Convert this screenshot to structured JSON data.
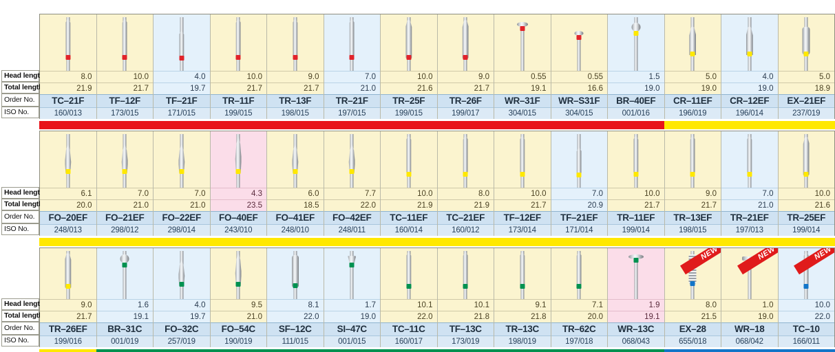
{
  "row_labels": [
    "Head length",
    "Total length",
    "Order No.",
    "ISO No."
  ],
  "palette": {
    "cream": "#fbf4cf",
    "blue": "#e4f1fb",
    "pink": "#fbdde9",
    "order_bg": "#cfe2f2",
    "iso_bg": "#dceaf6",
    "red": "#e8131a",
    "yellow": "#ffe800",
    "green": "#009150",
    "blue_bar": "#1275c8",
    "new_badge": "#e01b1b"
  },
  "new_badge_label": "NEW",
  "bands": [
    {
      "name": "band-1",
      "bottom_bar": [
        {
          "color": "#e8131a",
          "span": 11
        },
        {
          "color": "#ffe800",
          "span": 3
        }
      ],
      "columns": [
        {
          "bg": "cream",
          "head_length": "8.0",
          "total_length": "21.9",
          "order_no": "TC–21F",
          "iso_no": "160/013",
          "shape": "needle",
          "ring": "#e1232a",
          "new": false
        },
        {
          "bg": "cream",
          "head_length": "10.0",
          "total_length": "21.7",
          "order_no": "TF–12F",
          "iso_no": "173/015",
          "shape": "needle",
          "ring": "#e1232a",
          "new": false
        },
        {
          "bg": "blue",
          "head_length": "4.0",
          "total_length": "19.7",
          "order_no": "TF–21F",
          "iso_no": "171/015",
          "shape": "needle-short",
          "ring": "#e1232a",
          "new": false
        },
        {
          "bg": "cream",
          "head_length": "10.0",
          "total_length": "21.7",
          "order_no": "TR–11F",
          "iso_no": "199/015",
          "shape": "taper",
          "ring": "#e1232a",
          "new": false
        },
        {
          "bg": "cream",
          "head_length": "9.0",
          "total_length": "21.7",
          "order_no": "TR–13F",
          "iso_no": "198/015",
          "shape": "taper",
          "ring": "#e1232a",
          "new": false
        },
        {
          "bg": "blue",
          "head_length": "7.0",
          "total_length": "21.0",
          "order_no": "TR–21F",
          "iso_no": "197/015",
          "shape": "taper",
          "ring": "#e1232a",
          "new": false
        },
        {
          "bg": "cream",
          "head_length": "10.0",
          "total_length": "21.6",
          "order_no": "TR–25F",
          "iso_no": "199/015",
          "shape": "round-end",
          "ring": "#e1232a",
          "new": false
        },
        {
          "bg": "cream",
          "head_length": "9.0",
          "total_length": "21.7",
          "order_no": "TR–26F",
          "iso_no": "199/017",
          "shape": "round-end",
          "ring": "#e1232a",
          "new": false
        },
        {
          "bg": "cream",
          "head_length": "0.55",
          "total_length": "19.1",
          "order_no": "WR–31F",
          "iso_no": "304/015",
          "shape": "wheel",
          "ring": "#e1232a",
          "new": false
        },
        {
          "bg": "cream",
          "head_length": "0.55",
          "total_length": "16.6",
          "order_no": "WR–S31F",
          "iso_no": "304/015",
          "shape": "wheel-small",
          "ring": "#e1232a",
          "new": false
        },
        {
          "bg": "blue",
          "head_length": "1.5",
          "total_length": "19.0",
          "order_no": "BR–40EF",
          "iso_no": "001/016",
          "shape": "ball",
          "ring": "#ffe800",
          "new": false
        },
        {
          "bg": "cream",
          "head_length": "5.0",
          "total_length": "19.0",
          "order_no": "CR–11EF",
          "iso_no": "196/019",
          "shape": "cone-round",
          "ring": "#ffe800",
          "new": false
        },
        {
          "bg": "blue",
          "head_length": "4.0",
          "total_length": "19.0",
          "order_no": "CR–12EF",
          "iso_no": "196/014",
          "shape": "cone-round",
          "ring": "#ffe800",
          "new": false
        },
        {
          "bg": "cream",
          "head_length": "5.0",
          "total_length": "18.9",
          "order_no": "EX–21EF",
          "iso_no": "237/019",
          "shape": "barrel",
          "ring": "#ffe800",
          "new": false
        }
      ]
    },
    {
      "name": "band-2",
      "bottom_bar": [
        {
          "color": "#ffe800",
          "span": 14
        }
      ],
      "columns": [
        {
          "bg": "cream",
          "head_length": "6.1",
          "total_length": "20.0",
          "order_no": "FO–20EF",
          "iso_no": "248/013",
          "shape": "flame",
          "ring": "#ffe800",
          "new": false
        },
        {
          "bg": "cream",
          "head_length": "7.0",
          "total_length": "21.0",
          "order_no": "FO–21EF",
          "iso_no": "298/012",
          "shape": "flame",
          "ring": "#ffe800",
          "new": false
        },
        {
          "bg": "cream",
          "head_length": "7.0",
          "total_length": "21.0",
          "order_no": "FO–22EF",
          "iso_no": "298/014",
          "shape": "flame",
          "ring": "#ffe800",
          "new": false
        },
        {
          "bg": "pink",
          "head_length": "4.3",
          "total_length": "23.5",
          "order_no": "FO–40EF",
          "iso_no": "243/010",
          "shape": "flame-long",
          "ring": "#ffe800",
          "new": false
        },
        {
          "bg": "cream",
          "head_length": "6.0",
          "total_length": "18.5",
          "order_no": "FO–41EF",
          "iso_no": "248/010",
          "shape": "flame",
          "ring": "#ffe800",
          "new": false
        },
        {
          "bg": "cream",
          "head_length": "7.7",
          "total_length": "22.0",
          "order_no": "FO–42EF",
          "iso_no": "248/011",
          "shape": "flame",
          "ring": "#ffe800",
          "new": false
        },
        {
          "bg": "cream",
          "head_length": "10.0",
          "total_length": "21.9",
          "order_no": "TC–11EF",
          "iso_no": "160/014",
          "shape": "needle",
          "ring": "#ffe800",
          "new": false
        },
        {
          "bg": "cream",
          "head_length": "8.0",
          "total_length": "21.9",
          "order_no": "TC–21EF",
          "iso_no": "160/012",
          "shape": "needle",
          "ring": "#ffe800",
          "new": false
        },
        {
          "bg": "cream",
          "head_length": "10.0",
          "total_length": "21.7",
          "order_no": "TF–12EF",
          "iso_no": "173/014",
          "shape": "needle",
          "ring": "#ffe800",
          "new": false
        },
        {
          "bg": "blue",
          "head_length": "7.0",
          "total_length": "20.9",
          "order_no": "TF–21EF",
          "iso_no": "171/014",
          "shape": "needle-short",
          "ring": "#ffe800",
          "new": false
        },
        {
          "bg": "cream",
          "head_length": "10.0",
          "total_length": "21.7",
          "order_no": "TR–11EF",
          "iso_no": "199/014",
          "shape": "taper",
          "ring": "#ffe800",
          "new": false
        },
        {
          "bg": "cream",
          "head_length": "9.0",
          "total_length": "21.7",
          "order_no": "TR–13EF",
          "iso_no": "198/015",
          "shape": "taper",
          "ring": "#ffe800",
          "new": false
        },
        {
          "bg": "blue",
          "head_length": "7.0",
          "total_length": "21.0",
          "order_no": "TR–21EF",
          "iso_no": "197/013",
          "shape": "taper",
          "ring": "#ffe800",
          "new": false
        },
        {
          "bg": "cream",
          "head_length": "10.0",
          "total_length": "21.6",
          "order_no": "TR–25EF",
          "iso_no": "199/014",
          "shape": "round-end",
          "ring": "#ffe800",
          "new": false
        }
      ]
    },
    {
      "name": "band-3",
      "bottom_bar": [
        {
          "color": "#ffe800",
          "span": 1
        },
        {
          "color": "#009150",
          "span": 10
        },
        {
          "color": "#1275c8",
          "span": 3
        }
      ],
      "columns": [
        {
          "bg": "cream",
          "head_length": "9.0",
          "total_length": "21.7",
          "order_no": "TR–26EF",
          "iso_no": "199/016",
          "shape": "round-end",
          "ring": "#ffe800",
          "new": false
        },
        {
          "bg": "blue",
          "head_length": "1.6",
          "total_length": "19.1",
          "order_no": "BR–31C",
          "iso_no": "001/019",
          "shape": "ball",
          "ring": "#009150",
          "new": false
        },
        {
          "bg": "blue",
          "head_length": "4.0",
          "total_length": "19.7",
          "order_no": "FO–32C",
          "iso_no": "257/019",
          "shape": "flame",
          "ring": "#009150",
          "new": false
        },
        {
          "bg": "cream",
          "head_length": "9.5",
          "total_length": "21.0",
          "order_no": "FO–54C",
          "iso_no": "190/019",
          "shape": "flame-long",
          "ring": "#009150",
          "new": false
        },
        {
          "bg": "blue",
          "head_length": "8.1",
          "total_length": "22.0",
          "order_no": "SF–12C",
          "iso_no": "111/015",
          "shape": "cylinder",
          "ring": "#009150",
          "new": false
        },
        {
          "bg": "blue",
          "head_length": "1.7",
          "total_length": "19.0",
          "order_no": "SI–47C",
          "iso_no": "001/015",
          "shape": "inverted",
          "ring": "#009150",
          "new": false
        },
        {
          "bg": "cream",
          "head_length": "10.1",
          "total_length": "22.0",
          "order_no": "TC–11C",
          "iso_no": "160/017",
          "shape": "needle",
          "ring": "#009150",
          "new": false
        },
        {
          "bg": "cream",
          "head_length": "10.1",
          "total_length": "21.8",
          "order_no": "TF–13C",
          "iso_no": "173/019",
          "shape": "needle",
          "ring": "#009150",
          "new": false
        },
        {
          "bg": "cream",
          "head_length": "9.1",
          "total_length": "21.8",
          "order_no": "TR–13C",
          "iso_no": "198/019",
          "shape": "taper",
          "ring": "#009150",
          "new": false
        },
        {
          "bg": "cream",
          "head_length": "7.1",
          "total_length": "20.0",
          "order_no": "TR–62C",
          "iso_no": "197/018",
          "shape": "taper",
          "ring": "#009150",
          "new": false
        },
        {
          "bg": "pink",
          "head_length": "1.9",
          "total_length": "19.1",
          "order_no": "WR–13C",
          "iso_no": "068/043",
          "shape": "wheel-wide",
          "ring": "#009150",
          "new": false
        },
        {
          "bg": "cream",
          "head_length": "8.0",
          "total_length": "21.5",
          "order_no": "EX–28",
          "iso_no": "655/018",
          "shape": "spiral",
          "ring": "#1275c8",
          "new": true
        },
        {
          "bg": "cream",
          "head_length": "1.0",
          "total_length": "19.0",
          "order_no": "WR–18",
          "iso_no": "068/042",
          "shape": "tee",
          "ring": "#1275c8",
          "new": true
        },
        {
          "bg": "blue",
          "head_length": "10.0",
          "total_length": "22.0",
          "order_no": "TC–10",
          "iso_no": "166/011",
          "shape": "needle",
          "ring": "#1275c8",
          "new": true
        }
      ]
    }
  ]
}
